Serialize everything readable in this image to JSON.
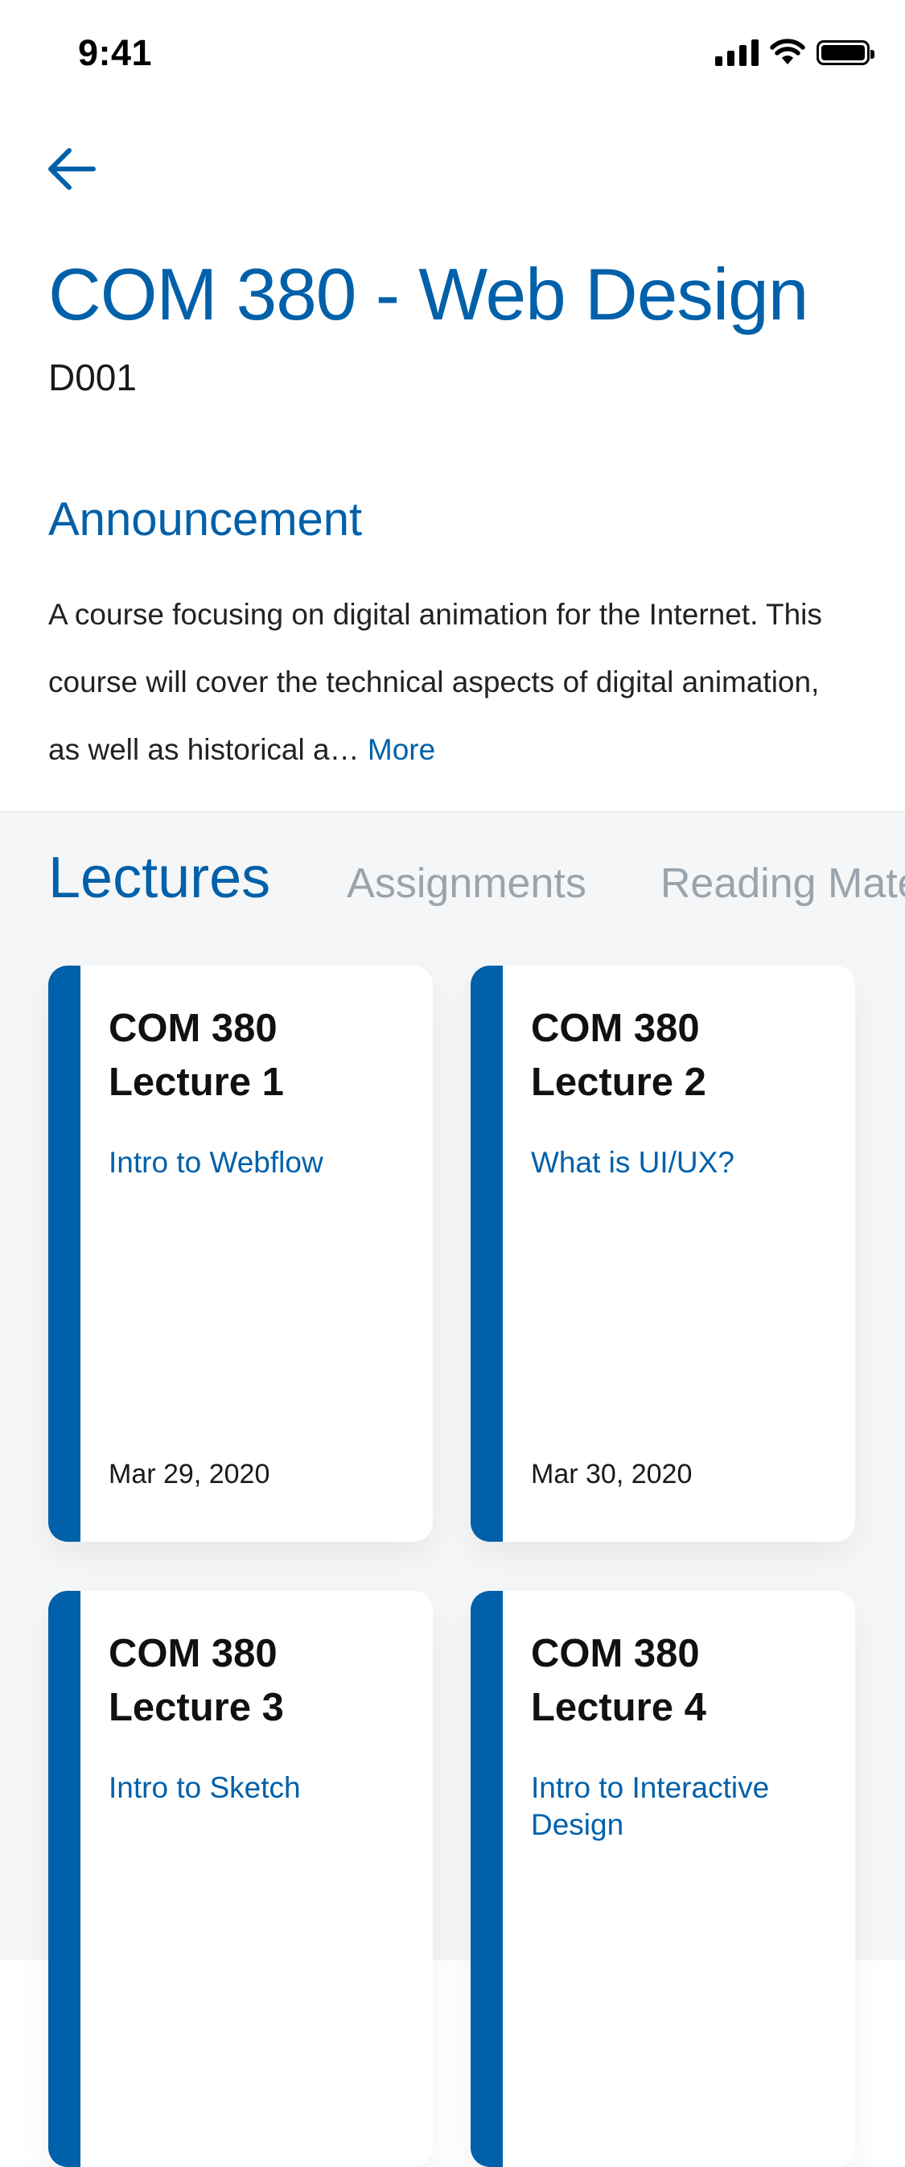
{
  "status_bar": {
    "time": "9:41"
  },
  "header": {
    "title": "COM 380 - Web Design",
    "code": "D001"
  },
  "announcement": {
    "heading": "Announcement",
    "text": "A course focusing on digital animation for the Internet. This course will cover the technical aspects of digital animation, as well as historical a…",
    "more_label": "More"
  },
  "tabs": [
    {
      "label": "Lectures",
      "active": true
    },
    {
      "label": "Assignments",
      "active": false
    },
    {
      "label": "Reading Materials",
      "active": false
    }
  ],
  "lectures": [
    {
      "course": "COM 380",
      "lecture": "Lecture 1",
      "topic": "Intro to Webflow",
      "date": "Mar 29, 2020"
    },
    {
      "course": "COM 380",
      "lecture": "Lecture 2",
      "topic": "What is UI/UX?",
      "date": "Mar 30, 2020"
    },
    {
      "course": "COM 380",
      "lecture": "Lecture 3",
      "topic": "Intro to Sketch",
      "date": ""
    },
    {
      "course": "COM 380",
      "lecture": "Lecture 4",
      "topic": "Intro to Interactive Design",
      "date": ""
    }
  ],
  "colors": {
    "accent": "#0060a9",
    "inactive_tab": "#9aa4ad",
    "background_lower": "#f5f6f7"
  }
}
